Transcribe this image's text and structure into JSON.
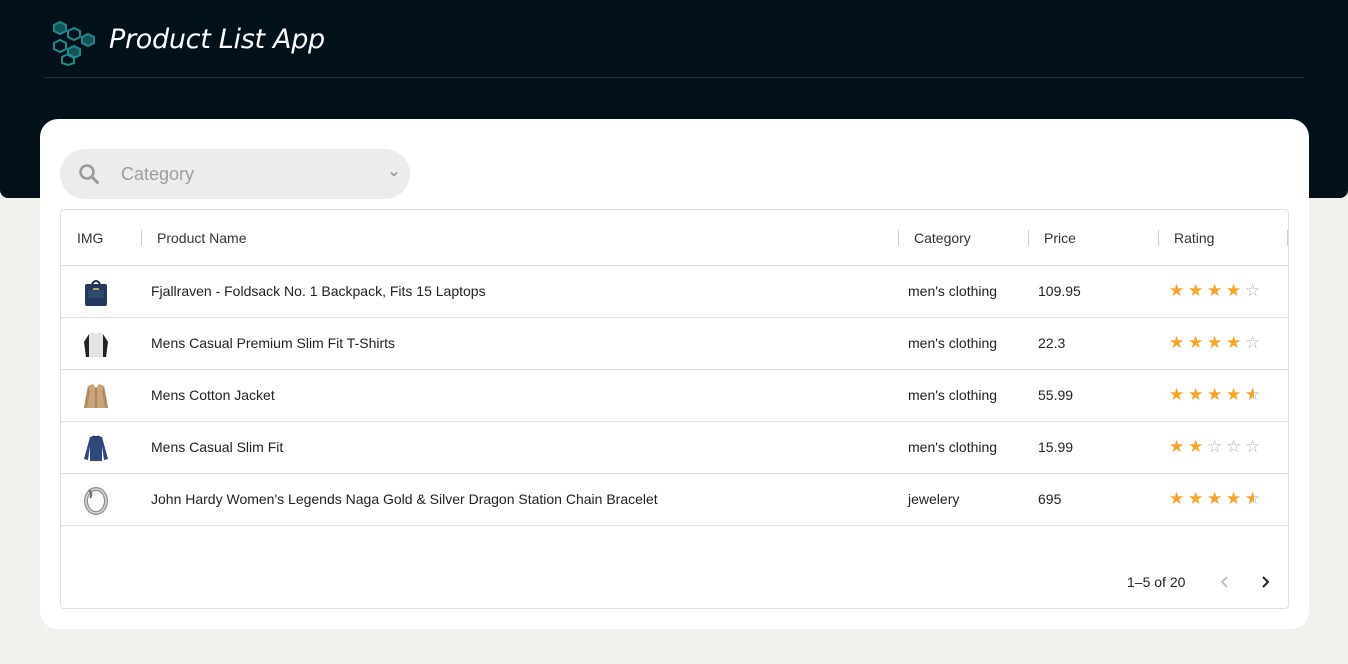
{
  "app": {
    "title": "Product List App",
    "logo_icon": "hexagon-cluster-icon",
    "accent": "#1f8a8a",
    "header_bg": "#03121a"
  },
  "search": {
    "placeholder": "Category",
    "icon": "search-icon",
    "dropdown_icon": "chevron-down-icon"
  },
  "table": {
    "columns": [
      "IMG",
      "Product Name",
      "Category",
      "Price",
      "Rating"
    ],
    "rows": [
      {
        "image": "backpack",
        "name": "Fjallraven - Foldsack No. 1 Backpack, Fits 15 Laptops",
        "category": "men's clothing",
        "price": "109.95",
        "rating": 4
      },
      {
        "image": "tshirt",
        "name": "Mens Casual Premium Slim Fit T-Shirts",
        "category": "men's clothing",
        "price": "22.3",
        "rating": 4
      },
      {
        "image": "jacket",
        "name": "Mens Cotton Jacket",
        "category": "men's clothing",
        "price": "55.99",
        "rating": 4.5
      },
      {
        "image": "longsleeve",
        "name": "Mens Casual Slim Fit",
        "category": "men's clothing",
        "price": "15.99",
        "rating": 2
      },
      {
        "image": "bracelet",
        "name": "John Hardy Women's Legends Naga Gold & Silver Dragon Station Chain Bracelet",
        "category": "jewelery",
        "price": "695",
        "rating": 4.5
      }
    ],
    "star_color": "#f5a623",
    "max_rating": 5
  },
  "pagination": {
    "label": "1–5 of 20",
    "prev_icon": "chevron-left-icon",
    "next_icon": "chevron-right-icon"
  }
}
